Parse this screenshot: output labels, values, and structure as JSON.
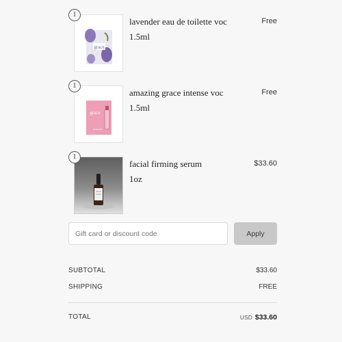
{
  "items": [
    {
      "qty": "1",
      "name": "lavender eau de toilette voc",
      "size": "1.5ml",
      "price": "Free",
      "image_icon": "lavender-sachet-icon"
    },
    {
      "qty": "1",
      "name": "amazing grace intense voc",
      "size": "1.5ml",
      "price": "Free",
      "image_icon": "amazing-grace-vial-card-icon"
    },
    {
      "qty": "1",
      "name": "facial firming serum",
      "size": "1oz",
      "price": "$33.60",
      "image_icon": "serum-dropper-bottle-icon"
    }
  ],
  "discount": {
    "placeholder": "Gift card or discount code",
    "value": "",
    "apply_label": "Apply"
  },
  "summary": {
    "subtotal_label": "SUBTOTAL",
    "subtotal_value": "$33.60",
    "shipping_label": "SHIPPING",
    "shipping_value": "FREE",
    "total_label": "TOTAL",
    "currency": "USD",
    "total_value": "$33.60"
  },
  "colors": {
    "background": "#f7f7f7",
    "button": "#c8c8c8",
    "product_pink": "#e9a3b8",
    "product_lavender": "#8c78b8"
  }
}
